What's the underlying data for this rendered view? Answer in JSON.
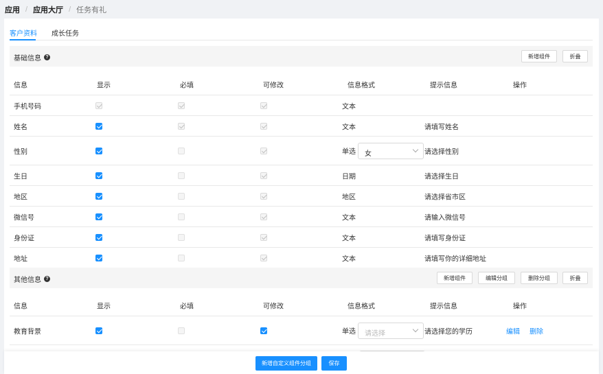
{
  "breadcrumb": {
    "item1": "应用",
    "item2": "应用大厅",
    "item3": "任务有礼",
    "sep": "/"
  },
  "tabs": [
    {
      "label": "客户资料",
      "active": true
    },
    {
      "label": "成长任务",
      "active": false
    }
  ],
  "section1": {
    "title": "基础信息",
    "buttons": {
      "add": "新增组件",
      "collapse": "折叠"
    }
  },
  "section2": {
    "title": "其他信息",
    "buttons": {
      "add": "新增组件",
      "edit": "编辑分组",
      "delete": "删除分组",
      "collapse": "折叠"
    }
  },
  "columns": {
    "name": "信息",
    "show": "显示",
    "required": "必填",
    "editable": "可修改",
    "format": "信息格式",
    "tip": "提示信息",
    "op": "操作"
  },
  "rows1": [
    {
      "name": "手机号码",
      "show": "disabled-checked",
      "required": "disabled-checked",
      "editable": "disabled-checked",
      "format": "文本",
      "tip": ""
    },
    {
      "name": "姓名",
      "show": "checked",
      "required": "disabled-checked",
      "editable": "disabled-checked",
      "format": "文本",
      "tip": "请填写姓名"
    },
    {
      "name": "性别",
      "show": "checked",
      "required": "disabled",
      "editable": "disabled-checked",
      "format": "单选",
      "select": "女",
      "tip": "请选择性别"
    },
    {
      "name": "生日",
      "show": "checked",
      "required": "disabled",
      "editable": "disabled-checked",
      "format": "日期",
      "tip": "请选择生日"
    },
    {
      "name": "地区",
      "show": "checked",
      "required": "disabled",
      "editable": "disabled-checked",
      "format": "地区",
      "tip": "请选择省市区"
    },
    {
      "name": "微信号",
      "show": "checked",
      "required": "disabled",
      "editable": "disabled-checked",
      "format": "文本",
      "tip": "请输入微信号"
    },
    {
      "name": "身份证",
      "show": "checked",
      "required": "disabled",
      "editable": "disabled-checked",
      "format": "文本",
      "tip": "请填写身份证"
    },
    {
      "name": "地址",
      "show": "checked",
      "required": "disabled",
      "editable": "disabled-checked",
      "format": "文本",
      "tip": "请填写你的详细地址"
    }
  ],
  "rows2": [
    {
      "name": "教育背景",
      "show": "checked",
      "required": "disabled",
      "editable": "checked",
      "format": "单选",
      "select_placeholder": "请选择",
      "tip": "请选择您的学历",
      "edit": "编辑",
      "delete": "删除"
    }
  ],
  "footer": {
    "add_group": "新增自定义组件分组",
    "save": "保存"
  },
  "colors": {
    "primary": "#1890ff",
    "section_bg": "#f5f5f5",
    "page_bg": "#f0f2f5"
  }
}
